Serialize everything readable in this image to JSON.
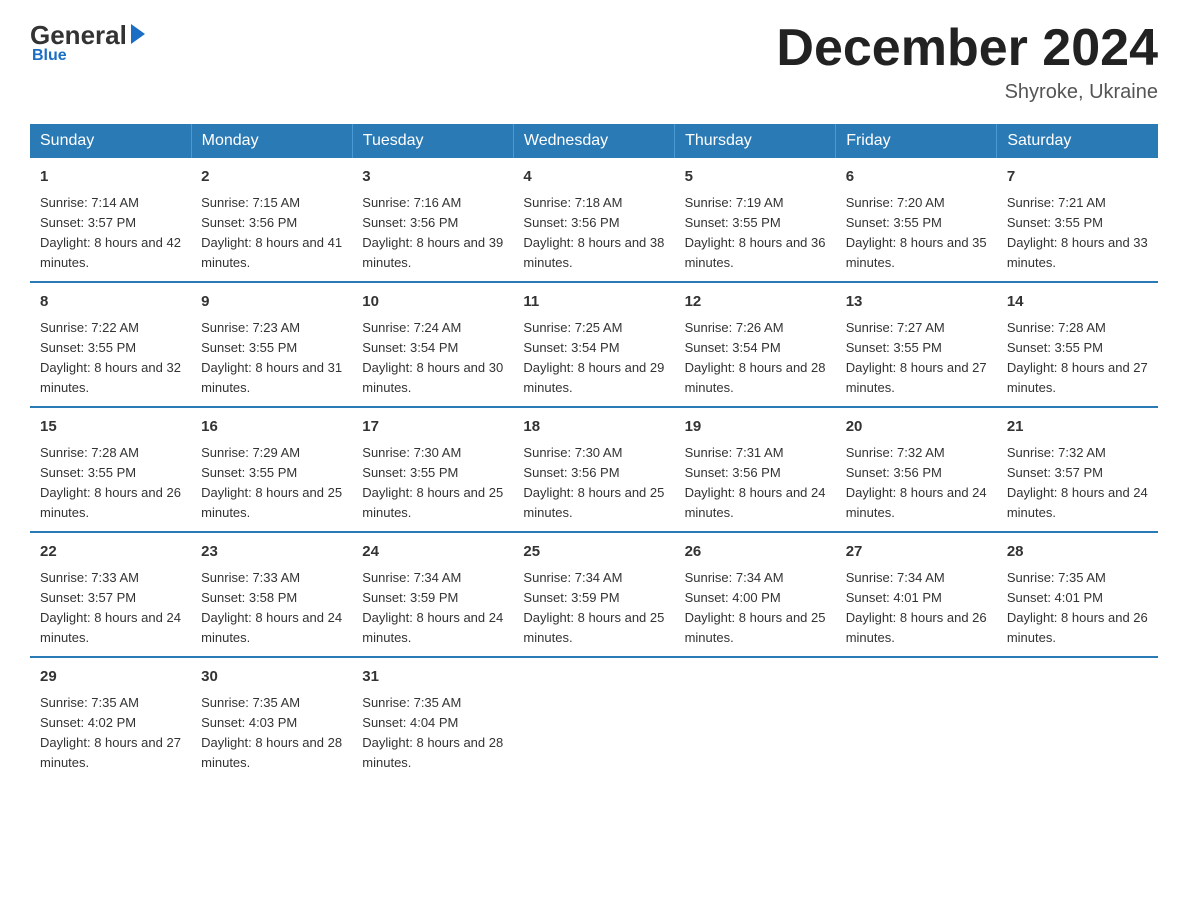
{
  "header": {
    "logo": {
      "general": "General",
      "blue": "Blue"
    },
    "title": "December 2024",
    "location": "Shyroke, Ukraine"
  },
  "days_of_week": [
    "Sunday",
    "Monday",
    "Tuesday",
    "Wednesday",
    "Thursday",
    "Friday",
    "Saturday"
  ],
  "weeks": [
    [
      {
        "day": "1",
        "sunrise": "7:14 AM",
        "sunset": "3:57 PM",
        "daylight": "8 hours and 42 minutes."
      },
      {
        "day": "2",
        "sunrise": "7:15 AM",
        "sunset": "3:56 PM",
        "daylight": "8 hours and 41 minutes."
      },
      {
        "day": "3",
        "sunrise": "7:16 AM",
        "sunset": "3:56 PM",
        "daylight": "8 hours and 39 minutes."
      },
      {
        "day": "4",
        "sunrise": "7:18 AM",
        "sunset": "3:56 PM",
        "daylight": "8 hours and 38 minutes."
      },
      {
        "day": "5",
        "sunrise": "7:19 AM",
        "sunset": "3:55 PM",
        "daylight": "8 hours and 36 minutes."
      },
      {
        "day": "6",
        "sunrise": "7:20 AM",
        "sunset": "3:55 PM",
        "daylight": "8 hours and 35 minutes."
      },
      {
        "day": "7",
        "sunrise": "7:21 AM",
        "sunset": "3:55 PM",
        "daylight": "8 hours and 33 minutes."
      }
    ],
    [
      {
        "day": "8",
        "sunrise": "7:22 AM",
        "sunset": "3:55 PM",
        "daylight": "8 hours and 32 minutes."
      },
      {
        "day": "9",
        "sunrise": "7:23 AM",
        "sunset": "3:55 PM",
        "daylight": "8 hours and 31 minutes."
      },
      {
        "day": "10",
        "sunrise": "7:24 AM",
        "sunset": "3:54 PM",
        "daylight": "8 hours and 30 minutes."
      },
      {
        "day": "11",
        "sunrise": "7:25 AM",
        "sunset": "3:54 PM",
        "daylight": "8 hours and 29 minutes."
      },
      {
        "day": "12",
        "sunrise": "7:26 AM",
        "sunset": "3:54 PM",
        "daylight": "8 hours and 28 minutes."
      },
      {
        "day": "13",
        "sunrise": "7:27 AM",
        "sunset": "3:55 PM",
        "daylight": "8 hours and 27 minutes."
      },
      {
        "day": "14",
        "sunrise": "7:28 AM",
        "sunset": "3:55 PM",
        "daylight": "8 hours and 27 minutes."
      }
    ],
    [
      {
        "day": "15",
        "sunrise": "7:28 AM",
        "sunset": "3:55 PM",
        "daylight": "8 hours and 26 minutes."
      },
      {
        "day": "16",
        "sunrise": "7:29 AM",
        "sunset": "3:55 PM",
        "daylight": "8 hours and 25 minutes."
      },
      {
        "day": "17",
        "sunrise": "7:30 AM",
        "sunset": "3:55 PM",
        "daylight": "8 hours and 25 minutes."
      },
      {
        "day": "18",
        "sunrise": "7:30 AM",
        "sunset": "3:56 PM",
        "daylight": "8 hours and 25 minutes."
      },
      {
        "day": "19",
        "sunrise": "7:31 AM",
        "sunset": "3:56 PM",
        "daylight": "8 hours and 24 minutes."
      },
      {
        "day": "20",
        "sunrise": "7:32 AM",
        "sunset": "3:56 PM",
        "daylight": "8 hours and 24 minutes."
      },
      {
        "day": "21",
        "sunrise": "7:32 AM",
        "sunset": "3:57 PM",
        "daylight": "8 hours and 24 minutes."
      }
    ],
    [
      {
        "day": "22",
        "sunrise": "7:33 AM",
        "sunset": "3:57 PM",
        "daylight": "8 hours and 24 minutes."
      },
      {
        "day": "23",
        "sunrise": "7:33 AM",
        "sunset": "3:58 PM",
        "daylight": "8 hours and 24 minutes."
      },
      {
        "day": "24",
        "sunrise": "7:34 AM",
        "sunset": "3:59 PM",
        "daylight": "8 hours and 24 minutes."
      },
      {
        "day": "25",
        "sunrise": "7:34 AM",
        "sunset": "3:59 PM",
        "daylight": "8 hours and 25 minutes."
      },
      {
        "day": "26",
        "sunrise": "7:34 AM",
        "sunset": "4:00 PM",
        "daylight": "8 hours and 25 minutes."
      },
      {
        "day": "27",
        "sunrise": "7:34 AM",
        "sunset": "4:01 PM",
        "daylight": "8 hours and 26 minutes."
      },
      {
        "day": "28",
        "sunrise": "7:35 AM",
        "sunset": "4:01 PM",
        "daylight": "8 hours and 26 minutes."
      }
    ],
    [
      {
        "day": "29",
        "sunrise": "7:35 AM",
        "sunset": "4:02 PM",
        "daylight": "8 hours and 27 minutes."
      },
      {
        "day": "30",
        "sunrise": "7:35 AM",
        "sunset": "4:03 PM",
        "daylight": "8 hours and 28 minutes."
      },
      {
        "day": "31",
        "sunrise": "7:35 AM",
        "sunset": "4:04 PM",
        "daylight": "8 hours and 28 minutes."
      },
      null,
      null,
      null,
      null
    ]
  ]
}
